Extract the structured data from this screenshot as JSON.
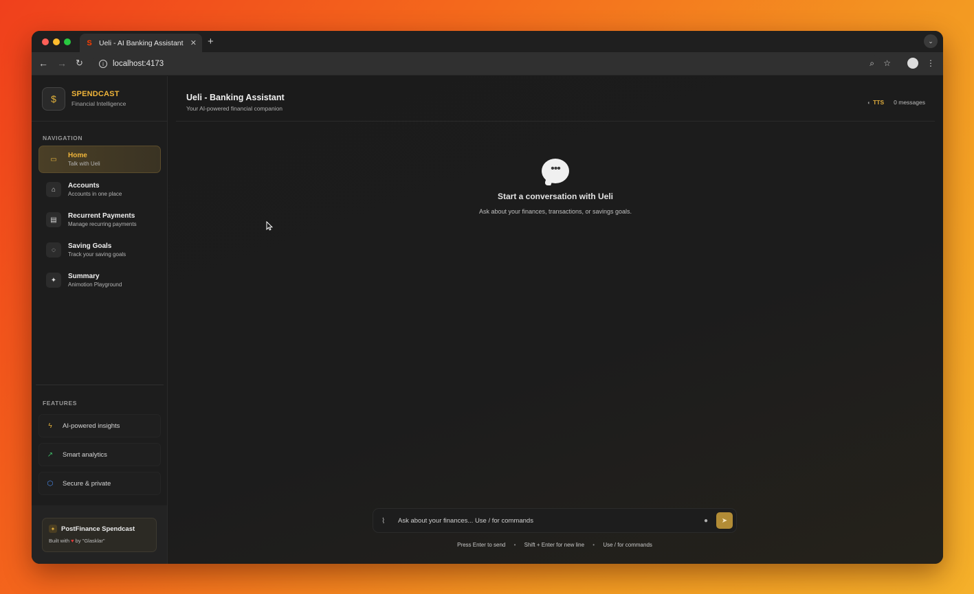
{
  "browser": {
    "tab_title": "Ueli - AI Banking Assistant",
    "url": "localhost:4173"
  },
  "brand": {
    "name": "SPENDCAST",
    "subtitle": "Financial Intelligence"
  },
  "sidebar": {
    "nav_label": "NAVIGATION",
    "items": [
      {
        "title": "Home",
        "subtitle": "Talk with Ueli",
        "icon": "chat-icon"
      },
      {
        "title": "Accounts",
        "subtitle": "Accounts in one place",
        "icon": "home-icon"
      },
      {
        "title": "Recurrent Payments",
        "subtitle": "Manage recurring payments",
        "icon": "card-icon"
      },
      {
        "title": "Saving Goals",
        "subtitle": "Track your saving goals",
        "icon": "piggy-bank-icon"
      },
      {
        "title": "Summary",
        "subtitle": "Animotion Playground",
        "icon": "sparkles-icon"
      }
    ],
    "features_label": "FEATURES",
    "features": [
      {
        "text": "AI-powered insights",
        "icon": "lightning-icon",
        "color": "#e6b23a"
      },
      {
        "text": "Smart analytics",
        "icon": "trending-up-icon",
        "color": "#3fbf6a"
      },
      {
        "text": "Secure & private",
        "icon": "shield-icon",
        "color": "#4a8cf0"
      }
    ],
    "footer": {
      "title": "PostFinance Spendcast",
      "built_prefix": "Built with",
      "built_suffix": "by \"Glasklar\""
    }
  },
  "header": {
    "title": "Ueli - Banking Assistant",
    "subtitle": "Your AI-powered financial companion",
    "tts_label": "TTS",
    "message_count": "0 messages"
  },
  "empty_state": {
    "title": "Start a conversation with Ueli",
    "subtitle": "Ask about your finances, transactions, or savings goals."
  },
  "composer": {
    "placeholder": "Ask about your finances... Use / for commands",
    "value": ""
  },
  "hints": {
    "send": "Press Enter to send",
    "newline": "Shift + Enter for new line",
    "commands": "Use / for commands"
  },
  "colors": {
    "accent": "#f0b53a",
    "send_button": "#b28c36"
  }
}
